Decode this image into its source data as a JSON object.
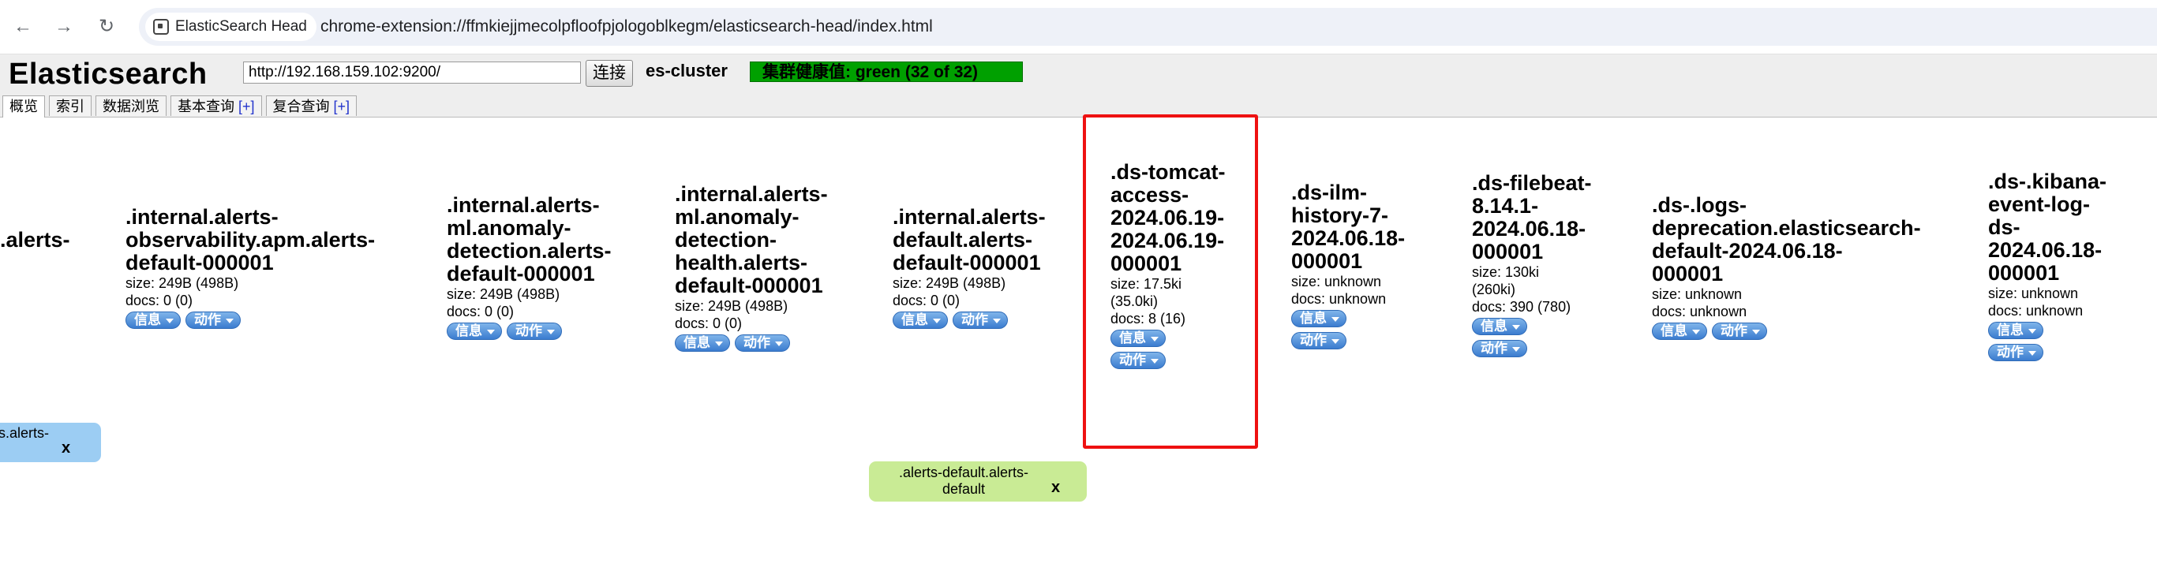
{
  "browser": {
    "back_icon": "arrow-left-icon",
    "forward_icon": "arrow-right-icon",
    "reload_icon": "reload-icon",
    "site_chip": "ElasticSearch Head",
    "url": "chrome-extension://ffmkiejjmecolpfloofpjologoblkegm/elasticsearch-head/index.html"
  },
  "header": {
    "brand": "Elasticsearch",
    "cluster_url": "http://192.168.159.102:9200/",
    "connect_label": "连接",
    "cluster_name": "es-cluster",
    "health": "集群健康值: green (32 of 32)",
    "health_color": "#00a000"
  },
  "tabs": [
    {
      "label": "概览",
      "plus": ""
    },
    {
      "label": "索引",
      "plus": ""
    },
    {
      "label": "数据浏览",
      "plus": ""
    },
    {
      "label": "基本查询 ",
      "plus": "[+]"
    },
    {
      "label": "复合查询 ",
      "plus": "[+]"
    }
  ],
  "buttons": {
    "info": "信息",
    "action": "动作"
  },
  "indices": [
    {
      "name": ".alerts-",
      "size": "",
      "docs": ""
    },
    {
      "name": ".internal.alerts-\nobservability.apm.alerts-\ndefault-000001",
      "size": "size: 249B (498B)",
      "docs": "docs: 0 (0)"
    },
    {
      "name": ".internal.alerts-\nml.anomaly-\ndetection.alerts-\ndefault-000001",
      "size": "size: 249B (498B)",
      "docs": "docs: 0 (0)"
    },
    {
      "name": ".internal.alerts-\nml.anomaly-\ndetection-\nhealth.alerts-\ndefault-000001",
      "size": "size: 249B (498B)",
      "docs": "docs: 0 (0)"
    },
    {
      "name": ".internal.alerts-\ndefault.alerts-\ndefault-000001",
      "size": "size: 249B (498B)",
      "docs": "docs: 0 (0)"
    },
    {
      "name": ".ds-tomcat-\naccess-\n2024.06.19-\n2024.06.19-\n000001",
      "size": "size: 17.5ki\n(35.0ki)",
      "docs": "docs: 8 (16)"
    },
    {
      "name": ".ds-ilm-\nhistory-7-\n2024.06.18-\n000001",
      "size": "size: unknown",
      "docs": "docs: unknown"
    },
    {
      "name": ".ds-filebeat-\n8.14.1-\n2024.06.18-\n000001",
      "size": "size: 130ki\n(260ki)",
      "docs": "docs: 390 (780)"
    },
    {
      "name": ".ds-.logs-\ndeprecation.elasticsearch-\ndefault-2024.06.18-\n000001",
      "size": "size: unknown",
      "docs": "docs: unknown"
    },
    {
      "name": ".ds-.kibana-\nevent-log-\nds-\n2024.06.18-\n000001",
      "size": "size: unknown",
      "docs": "docs: unknown"
    }
  ],
  "aliases": [
    {
      "label": "s.alerts-",
      "close": "x",
      "color": "#9ccdf3"
    },
    {
      "label": ".alerts-default.alerts-\ndefault",
      "close": "x",
      "color": "#c9eb95"
    }
  ]
}
